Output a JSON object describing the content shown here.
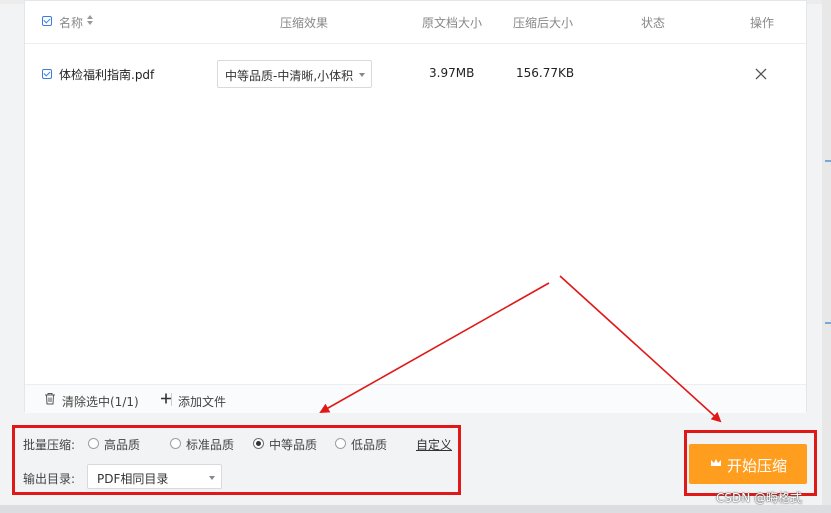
{
  "table": {
    "headers": {
      "name": "名称",
      "effect": "压缩效果",
      "original_size": "原文档大小",
      "compressed_size": "压缩后大小",
      "status": "状态",
      "action": "操作"
    },
    "rows": [
      {
        "file_name": "体检福利指南.pdf",
        "effect": "中等品质-中清晰,小体积",
        "original_size": "3.97MB",
        "compressed_size": "156.77KB",
        "status": ""
      }
    ]
  },
  "footer": {
    "clear_selected": "清除选中(1/1)",
    "add_file": "添加文件"
  },
  "options": {
    "batch_label": "批量压缩:",
    "qualities": [
      "高品质",
      "标准品质",
      "中等品质",
      "低品质"
    ],
    "selected_quality": "中等品质",
    "custom_link": "自定义",
    "output_label": "输出目录:",
    "output_value": "PDF相同目录"
  },
  "start_button": {
    "label": "开始压缩"
  },
  "watermark": "CSDN @晦格式",
  "colors": {
    "accent": "#3b7ddd",
    "start_button": "#ff9d1e",
    "annotation": "#e01818"
  },
  "icons": [
    "checkbox-icon",
    "sort-icon",
    "chevron-down-icon",
    "close-icon",
    "trash-icon",
    "plus-icon",
    "crown-icon"
  ]
}
